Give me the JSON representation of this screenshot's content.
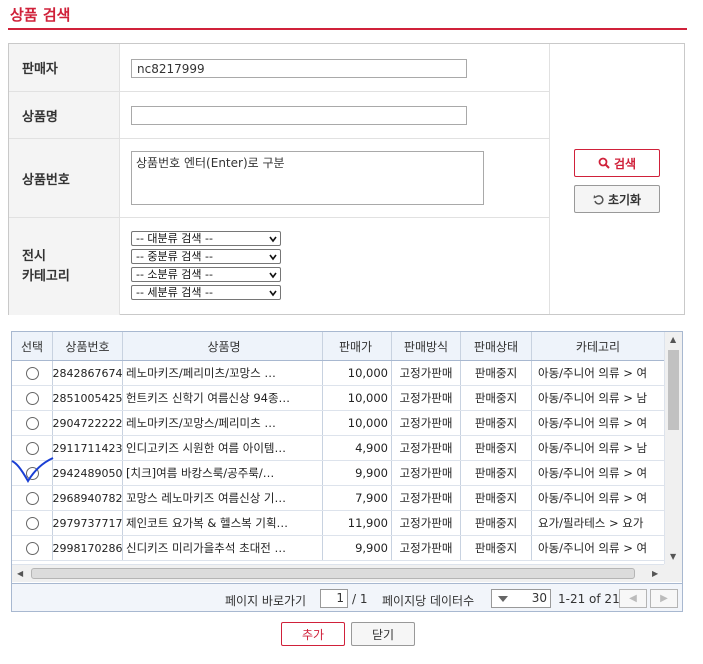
{
  "page": {
    "title": "상품 검색"
  },
  "form": {
    "seller_label": "판매자",
    "seller_value": "nc8217999",
    "product_name_label": "상품명",
    "product_name_value": "",
    "product_no_label": "상품번호",
    "product_no_placeholder": "상품번호 엔터(Enter)로 구분",
    "category_label_1": "전시",
    "category_label_2": "카테고리",
    "category_selects": [
      "-- 대분류 검색 --",
      "-- 중분류 검색 --",
      "-- 소분류 검색 --",
      "-- 세분류 검색 --"
    ],
    "search_button": "검색",
    "reset_button": "초기화"
  },
  "grid": {
    "headers": [
      "선택",
      "상품번호",
      "상품명",
      "판매가",
      "판매방식",
      "판매상태",
      "카테고리"
    ],
    "rows": [
      {
        "no": "2842867674",
        "name": "레노마키즈/페리미츠/꼬망스 …",
        "price": "10,000",
        "method": "고정가판매",
        "status": "판매중지",
        "category": "아동/주니어 의류 > 여"
      },
      {
        "no": "2851005425",
        "name": "헌트키즈 신학기 여름신상 94종…",
        "price": "10,000",
        "method": "고정가판매",
        "status": "판매중지",
        "category": "아동/주니어 의류 > 남"
      },
      {
        "no": "2904722222",
        "name": "레노마키즈/꼬망스/페리미츠 …",
        "price": "10,000",
        "method": "고정가판매",
        "status": "판매중지",
        "category": "아동/주니어 의류 > 여"
      },
      {
        "no": "2911711423",
        "name": "인디고키즈 시원한 여름 아이템…",
        "price": "4,900",
        "method": "고정가판매",
        "status": "판매중지",
        "category": "아동/주니어 의류 > 남"
      },
      {
        "no": "2942489050",
        "name": "[치크]여름 바캉스룩/공주룩/…",
        "price": "9,900",
        "method": "고정가판매",
        "status": "판매중지",
        "category": "아동/주니어 의류 > 여"
      },
      {
        "no": "2968940782",
        "name": "꼬망스 레노마키즈 여름신상 기…",
        "price": "7,900",
        "method": "고정가판매",
        "status": "판매중지",
        "category": "아동/주니어 의류 > 여"
      },
      {
        "no": "2979737717",
        "name": "제인코트 요가복 & 헬스복 기획…",
        "price": "11,900",
        "method": "고정가판매",
        "status": "판매중지",
        "category": "요가/필라테스 > 요가"
      },
      {
        "no": "2998170286",
        "name": "신디키즈 미리가을추석 초대전 …",
        "price": "9,900",
        "method": "고정가판매",
        "status": "판매중지",
        "category": "아동/주니어 의류 > 여"
      }
    ]
  },
  "pager": {
    "goto_label": "페이지 바로가기",
    "current_page": "1",
    "total_pages": "/ 1",
    "per_page_label": "페이지당 데이터수",
    "per_page_value": "30",
    "range": "1-21 of 21"
  },
  "footer": {
    "add_button": "추가",
    "close_button": "닫기"
  },
  "colors": {
    "accent": "#d0213a",
    "grid_border": "#a8b8d0"
  },
  "icons": [
    "search-icon",
    "reset-icon",
    "chevron-down-icon",
    "radio-icon",
    "prev-page-icon",
    "next-page-icon"
  ]
}
